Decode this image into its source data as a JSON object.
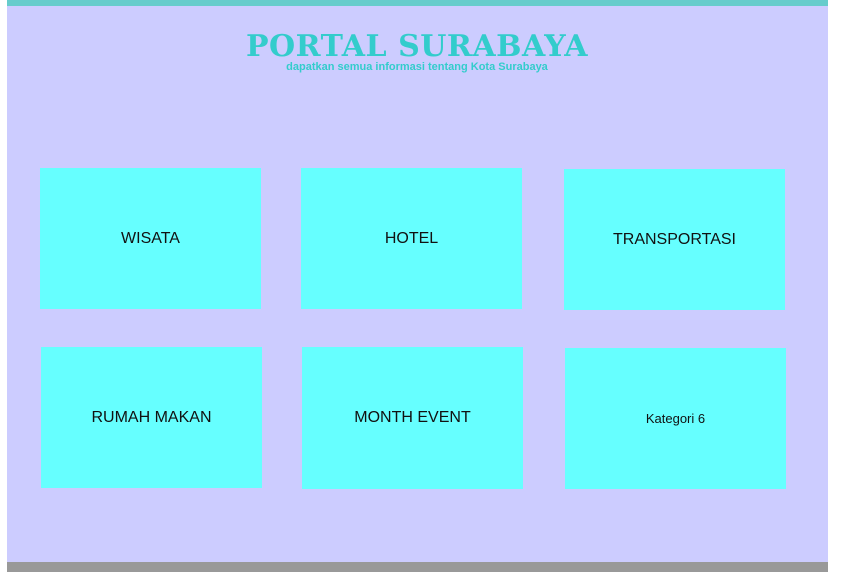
{
  "header": {
    "title": "PORTAL SURABAYA",
    "tagline": "dapatkan semua informasi tentang Kota Surabaya"
  },
  "categories": [
    {
      "label": "WISATA"
    },
    {
      "label": "HOTEL"
    },
    {
      "label": "TRANSPORTASI"
    },
    {
      "label": "RUMAH MAKAN"
    },
    {
      "label": "MONTH EVENT"
    },
    {
      "label": "Kategori 6"
    }
  ],
  "colors": {
    "background": "#ccccff",
    "top_bar": "#66cccc",
    "bottom_bar": "#999999",
    "title": "#33cccc",
    "tile": "#66ffff"
  }
}
